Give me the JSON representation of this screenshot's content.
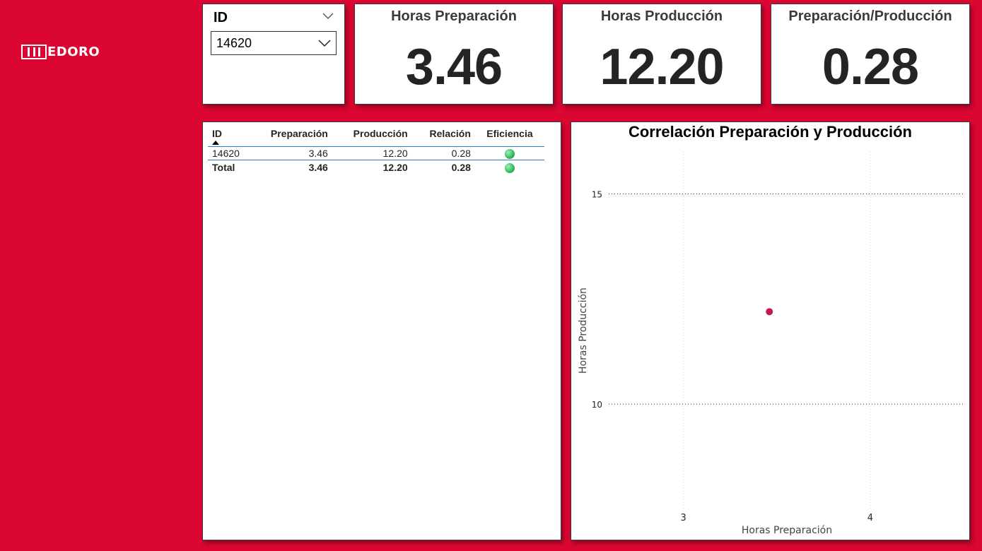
{
  "brand": {
    "logo_text": "EDORO"
  },
  "slicer": {
    "title": "ID",
    "selected": "14620"
  },
  "kpis": [
    {
      "title": "Horas Preparación",
      "value": "3.46"
    },
    {
      "title": "Horas Producción",
      "value": "12.20"
    },
    {
      "title": "Preparación/Producción",
      "value": "0.28"
    }
  ],
  "table": {
    "headers": [
      "ID",
      "Preparación",
      "Producción",
      "Relación",
      "Eficiencia"
    ],
    "rows": [
      {
        "id": "14620",
        "preparacion": "3.46",
        "produccion": "12.20",
        "relacion": "0.28",
        "eficiencia": "green"
      }
    ],
    "total": {
      "label": "Total",
      "preparacion": "3.46",
      "produccion": "12.20",
      "relacion": "0.28",
      "eficiencia": "green"
    }
  },
  "chart_data": {
    "type": "scatter",
    "title": "Correlación Preparación y Producción",
    "xlabel": "Horas Preparación",
    "ylabel": "Horas Producción",
    "xlim": [
      2.6,
      4.5
    ],
    "ylim": [
      7.5,
      16
    ],
    "xticks": [
      3,
      4
    ],
    "yticks": [
      10,
      15
    ],
    "points": [
      {
        "x": 3.46,
        "y": 12.2
      }
    ],
    "point_color": "#c2185b",
    "grid": true
  }
}
